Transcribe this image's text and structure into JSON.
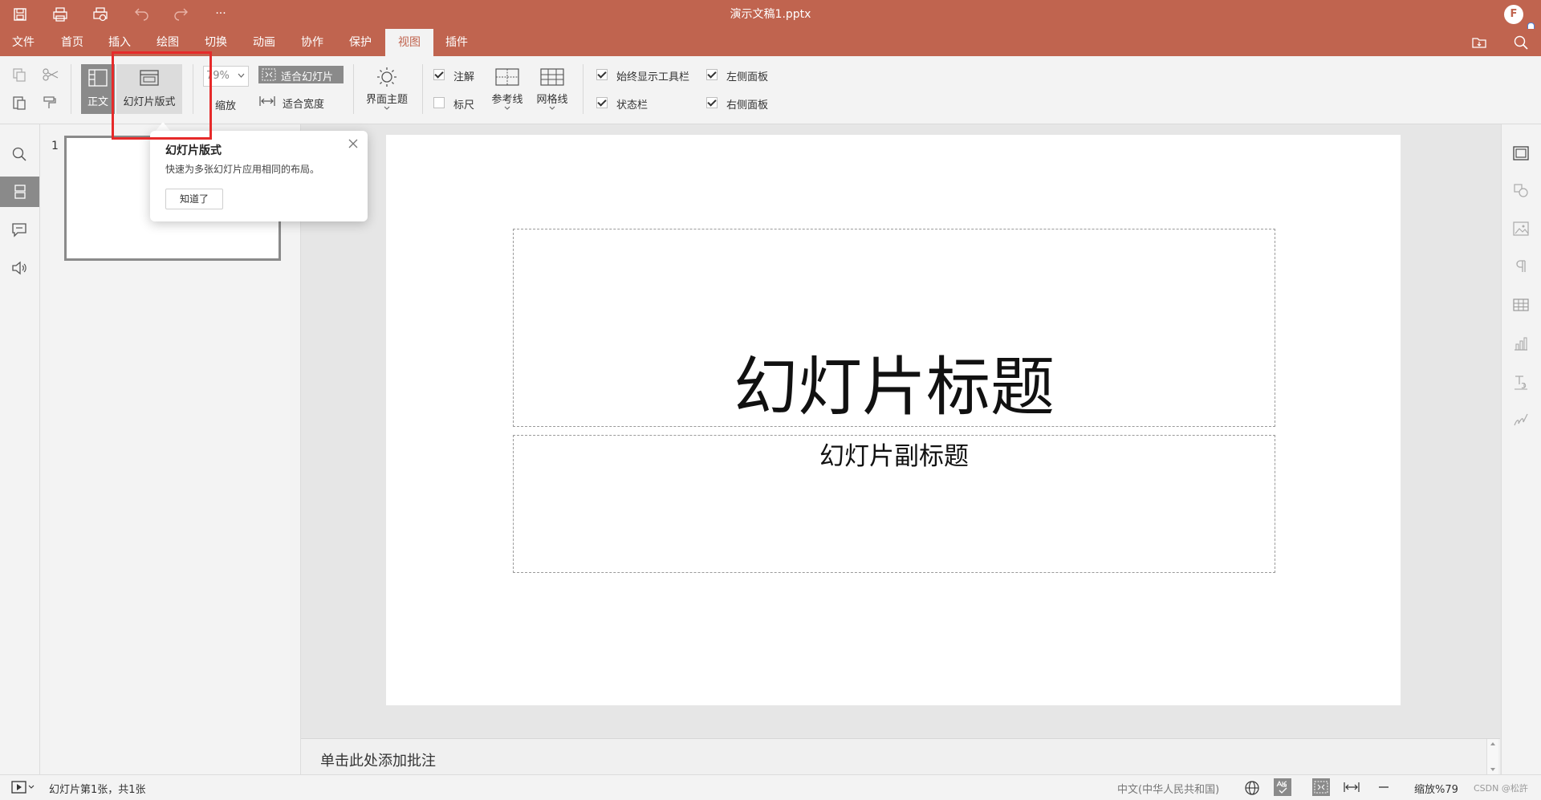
{
  "titlebar": {
    "document_title": "演示文稿1.pptx",
    "avatar_initial": "F",
    "quick_access": [
      "save-icon",
      "print-icon",
      "print-preview-icon",
      "undo-icon",
      "redo-icon",
      "more-icon"
    ],
    "more_label": "···"
  },
  "menu": {
    "tabs": [
      "文件",
      "首页",
      "插入",
      "绘图",
      "切换",
      "动画",
      "协作",
      "保护",
      "视图",
      "插件"
    ],
    "active": "视图"
  },
  "ribbon": {
    "normal_view_label": "正文",
    "slide_master_label": "幻灯片版式",
    "zoom_value": "79%",
    "zoom_label": "缩放",
    "fit_slide_label": "适合幻灯片",
    "fit_width_label": "适合宽度",
    "theme_label": "界面主题",
    "notes_label": "注解",
    "ruler_label": "标尺",
    "guides_label": "参考线",
    "gridlines_label": "网格线",
    "always_toolbar_label": "始终显示工具栏",
    "statusbar_label": "状态栏",
    "left_panel_label": "左侧面板",
    "right_panel_label": "右侧面板",
    "checks": {
      "notes": true,
      "ruler": false,
      "always_toolbar": true,
      "statusbar": true,
      "left_panel": true,
      "right_panel": true
    }
  },
  "tooltip": {
    "title": "幻灯片版式",
    "body": "快速为多张幻灯片应用相同的布局。",
    "button": "知道了"
  },
  "thumbnails": {
    "number": "1"
  },
  "slide": {
    "title": "幻灯片标题",
    "subtitle": "幻灯片副标题"
  },
  "notes": {
    "placeholder": "单击此处添加批注"
  },
  "status": {
    "slide_info": "幻灯片第1张，共1张",
    "language": "中文(中华人民共和国)",
    "zoom_text": "缩放%79",
    "watermark": "CSDN @松許"
  },
  "colors": {
    "accent": "#c0644f",
    "highlight": "#e62a2a"
  }
}
